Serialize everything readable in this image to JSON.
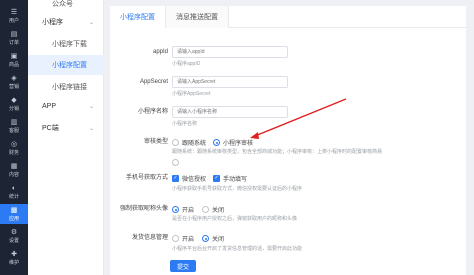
{
  "rail": {
    "items": [
      {
        "glyph": "☰",
        "label": "用户"
      },
      {
        "glyph": "▤",
        "label": "订单"
      },
      {
        "glyph": "▣",
        "label": "商品"
      },
      {
        "glyph": "◈",
        "label": "营销"
      },
      {
        "glyph": "◆",
        "label": "分销"
      },
      {
        "glyph": "▥",
        "label": "客服"
      },
      {
        "glyph": "◎",
        "label": "财务"
      },
      {
        "glyph": "▦",
        "label": "内容"
      },
      {
        "glyph": "◐",
        "label": "统计"
      },
      {
        "glyph": "▩",
        "label": "应用"
      },
      {
        "glyph": "⚙",
        "label": "设置"
      },
      {
        "glyph": "✚",
        "label": "维护"
      }
    ]
  },
  "subnav": {
    "top_partial": "公众号",
    "items": [
      {
        "label": "小程序",
        "type": "parent"
      },
      {
        "label": "小程序下载",
        "type": "child"
      },
      {
        "label": "小程序配置",
        "type": "child"
      },
      {
        "label": "小程序链接",
        "type": "child"
      },
      {
        "label": "APP",
        "type": "parent"
      },
      {
        "label": "PC端",
        "type": "parent"
      }
    ],
    "chevron": "⌄"
  },
  "tabs": [
    "小程序配置",
    "消息推送配置"
  ],
  "form": {
    "appid": {
      "label": "appId",
      "placeholder": "请输入appId",
      "hint": "小程序appID"
    },
    "appsecret": {
      "label": "AppSecret",
      "placeholder": "请输入AppSecret",
      "hint": "小程序AppSecret"
    },
    "appname": {
      "label": "小程序名称",
      "placeholder": "请输入小程序名称",
      "hint": "小程序名称"
    },
    "review": {
      "label": "审核类型",
      "options": [
        "跟随系统",
        "小程序审核"
      ],
      "hint": "跟随系统：跟随系统审核类型，包含全部商城功能；小程序审核：上架小程序时的配置审核简易"
    },
    "phone": {
      "label": "手机号获取方式",
      "options": [
        "微信授权",
        "手动填写"
      ],
      "hint": "小程序获取手机号获取方式，微信授权需要认证后的小程序"
    },
    "avatar": {
      "label": "强制获取昵称头像",
      "options": [
        "开启",
        "关闭"
      ],
      "hint": "是否在小程序用户授权之后，弹窗获取用户的昵称和头像"
    },
    "shipping": {
      "label": "发货信息管理",
      "options": [
        "开启",
        "关闭"
      ],
      "hint": "小程序平台后台开启了发货信息管理的话，需要开启此功能"
    },
    "submit": "提交"
  },
  "arrow_color": "#e02020",
  "accent": "#2d7bf4"
}
